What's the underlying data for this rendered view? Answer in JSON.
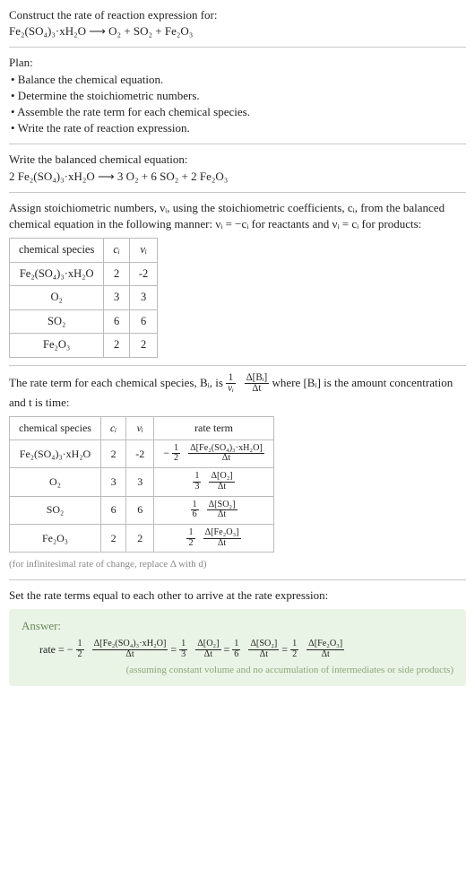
{
  "prompt": {
    "line1": "Construct the rate of reaction expression for:",
    "equation_text": "Fe₂(SO₄)₃·xH₂O ⟶ O₂ + SO₂ + Fe₂O₃"
  },
  "plan": {
    "title": "Plan:",
    "items": [
      "• Balance the chemical equation.",
      "• Determine the stoichiometric numbers.",
      "• Assemble the rate term for each chemical species.",
      "• Write the rate of reaction expression."
    ]
  },
  "balanced": {
    "intro": "Write the balanced chemical equation:",
    "equation_text": "2 Fe₂(SO₄)₃·xH₂O ⟶ 3 O₂ + 6 SO₂ + 2 Fe₂O₃"
  },
  "stoich": {
    "intro_a": "Assign stoichiometric numbers, νᵢ, using the stoichiometric coefficients, cᵢ, from the balanced chemical equation in the following manner: νᵢ = −cᵢ for reactants and νᵢ = cᵢ for products:",
    "headers": {
      "species": "chemical species",
      "c": "cᵢ",
      "v": "νᵢ"
    },
    "rows": [
      {
        "species": "Fe₂(SO₄)₃·xH₂O",
        "c": "2",
        "v": "-2"
      },
      {
        "species": "O₂",
        "c": "3",
        "v": "3"
      },
      {
        "species": "SO₂",
        "c": "6",
        "v": "6"
      },
      {
        "species": "Fe₂O₃",
        "c": "2",
        "v": "2"
      }
    ]
  },
  "rate_terms": {
    "intro_pre": "The rate term for each chemical species, Bᵢ, is ",
    "intro_post": " where [Bᵢ] is the amount concentration and t is time:",
    "frac1_num": "1",
    "frac1_den": "νᵢ",
    "frac2_num": "Δ[Bᵢ]",
    "frac2_den": "Δt",
    "headers": {
      "species": "chemical species",
      "c": "cᵢ",
      "v": "νᵢ",
      "term": "rate term"
    },
    "rows": [
      {
        "species": "Fe₂(SO₄)₃·xH₂O",
        "c": "2",
        "v": "-2",
        "coef_num": "1",
        "coef_den": "2",
        "sign": "−",
        "d_num": "Δ[Fe₂(SO₄)₃·xH₂O]",
        "d_den": "Δt"
      },
      {
        "species": "O₂",
        "c": "3",
        "v": "3",
        "coef_num": "1",
        "coef_den": "3",
        "sign": "",
        "d_num": "Δ[O₂]",
        "d_den": "Δt"
      },
      {
        "species": "SO₂",
        "c": "6",
        "v": "6",
        "coef_num": "1",
        "coef_den": "6",
        "sign": "",
        "d_num": "Δ[SO₂]",
        "d_den": "Δt"
      },
      {
        "species": "Fe₂O₃",
        "c": "2",
        "v": "2",
        "coef_num": "1",
        "coef_den": "2",
        "sign": "",
        "d_num": "Δ[Fe₂O₃]",
        "d_den": "Δt"
      }
    ],
    "note": "(for infinitesimal rate of change, replace Δ with d)"
  },
  "final_intro": "Set the rate terms equal to each other to arrive at the rate expression:",
  "answer": {
    "label": "Answer:",
    "rate_prefix": "rate = ",
    "terms": [
      {
        "sign": "−",
        "cn": "1",
        "cd": "2",
        "dn": "Δ[Fe₂(SO₄)₃·xH₂O]",
        "dd": "Δt"
      },
      {
        "sign": "",
        "cn": "1",
        "cd": "3",
        "dn": "Δ[O₂]",
        "dd": "Δt"
      },
      {
        "sign": "",
        "cn": "1",
        "cd": "6",
        "dn": "Δ[SO₂]",
        "dd": "Δt"
      },
      {
        "sign": "",
        "cn": "1",
        "cd": "2",
        "dn": "Δ[Fe₂O₃]",
        "dd": "Δt"
      }
    ],
    "note": "(assuming constant volume and no accumulation of intermediates or side products)"
  },
  "chart_data": {
    "type": "table",
    "title": "Stoichiometric numbers and rate terms for Fe2(SO4)3·xH2O decomposition",
    "balanced_equation": "2 Fe2(SO4)3·xH2O → 3 O2 + 6 SO2 + 2 Fe2O3",
    "species": [
      "Fe2(SO4)3·xH2O",
      "O2",
      "SO2",
      "Fe2O3"
    ],
    "c_i": [
      2,
      3,
      6,
      2
    ],
    "nu_i": [
      -2,
      3,
      6,
      2
    ],
    "rate_expression": "rate = -(1/2) d[Fe2(SO4)3·xH2O]/dt = (1/3) d[O2]/dt = (1/6) d[SO2]/dt = (1/2) d[Fe2O3]/dt"
  }
}
